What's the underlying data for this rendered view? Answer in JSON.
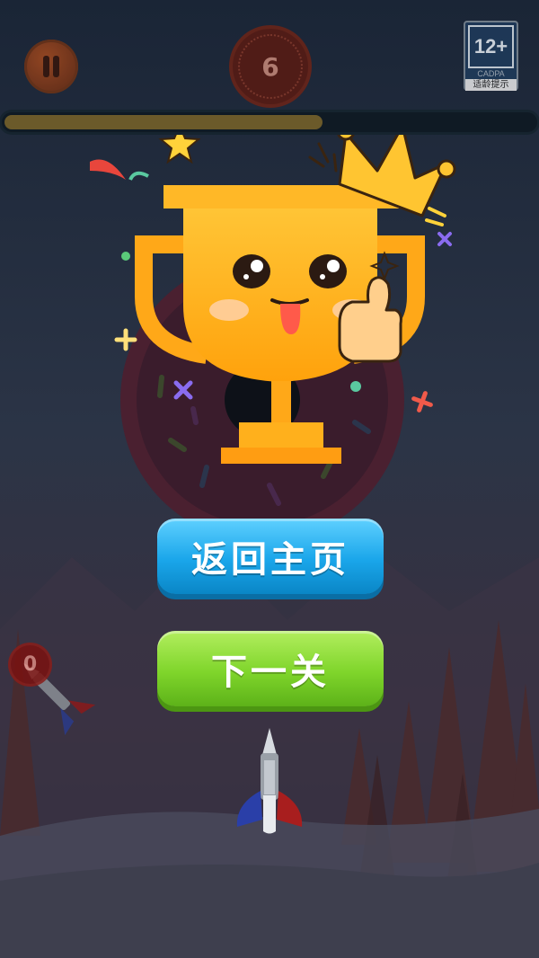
{
  "hud": {
    "pause_icon": "pause-icon",
    "level": "6",
    "progress": 0.6
  },
  "age_rating": {
    "age": "12+",
    "org": "CADPA",
    "tip": "适龄提示"
  },
  "result": {
    "trophy_icon": "happy-trophy-with-crown-icon"
  },
  "buttons": {
    "home_label": "返回主页",
    "next_label": "下一关"
  },
  "darts": {
    "remaining": "0",
    "dart_icon": "dart-icon"
  },
  "colors": {
    "home_button": "#1aa6ea",
    "next_button": "#7fd52b",
    "trophy": "#ffb019"
  }
}
